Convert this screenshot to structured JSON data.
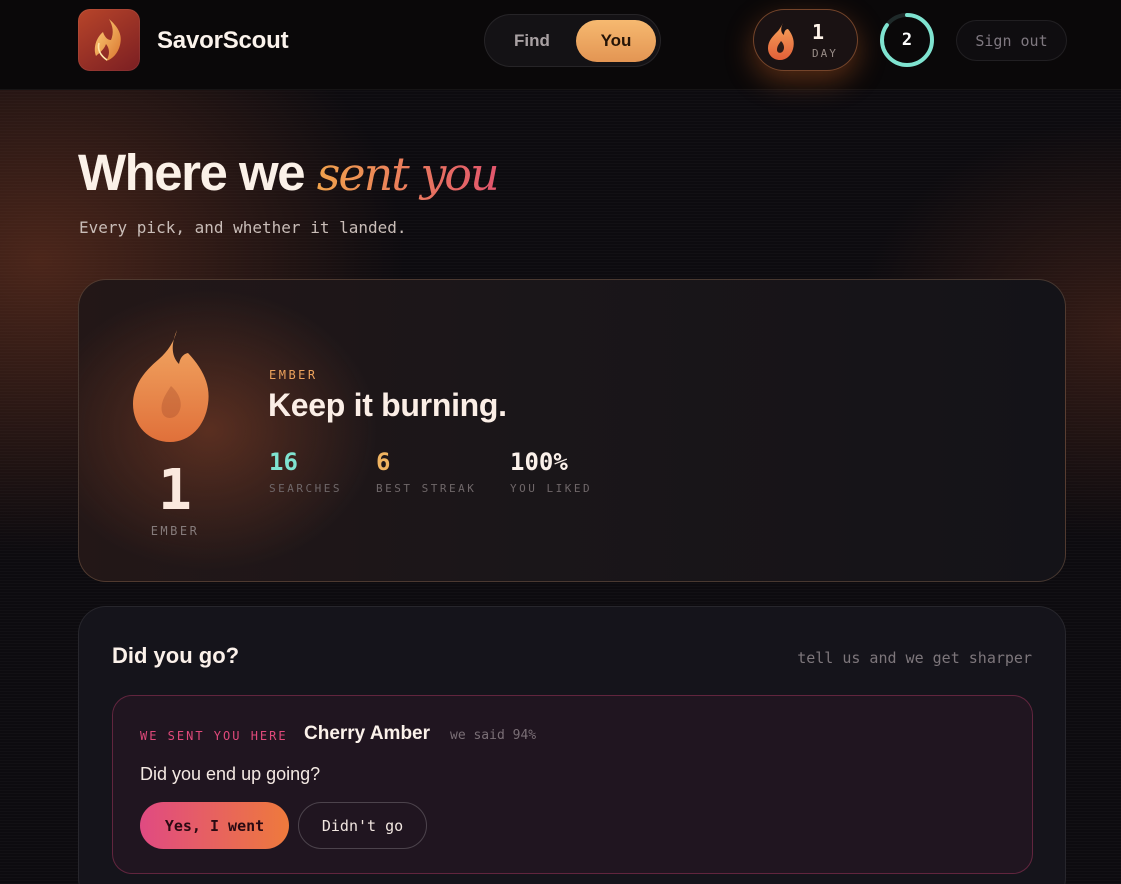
{
  "app": {
    "name": "SavorScout"
  },
  "nav": {
    "tabs": [
      {
        "label": "Find",
        "active": false
      },
      {
        "label": "You",
        "active": true
      }
    ],
    "streak": {
      "value": "1",
      "unit": "DAY",
      "icon": "flame-icon"
    },
    "progress_ring": {
      "value": "2",
      "fraction": 0.85,
      "color": "#7fe3d0"
    },
    "sign_out_label": "Sign out"
  },
  "page": {
    "title_main": "Where we",
    "title_accent": "sent you",
    "subtitle": "Every pick, and whether it landed."
  },
  "ember": {
    "count": "1",
    "count_label": "EMBER",
    "tier": "EMBER",
    "tagline": "Keep it burning.",
    "stats": [
      {
        "value": "16",
        "label": "SEARCHES",
        "color": "#7fe3d0"
      },
      {
        "value": "6",
        "label": "BEST STREAK",
        "color": "#f0b461"
      },
      {
        "value": "100%",
        "label": "YOU LIKED",
        "color": "#fbf1ea"
      }
    ]
  },
  "did_you_go": {
    "title": "Did you go?",
    "hint": "tell us and we get sharper",
    "item": {
      "kicker": "WE SENT YOU HERE",
      "name": "Cherry Amber",
      "score": "we said 94%",
      "question": "Did you end up going?",
      "yes_label": "Yes, I went",
      "no_label": "Didn't go"
    }
  },
  "colors": {
    "accent_orange": "#f0a24c",
    "accent_pink": "#e04a82",
    "teal": "#7fe3d0"
  }
}
